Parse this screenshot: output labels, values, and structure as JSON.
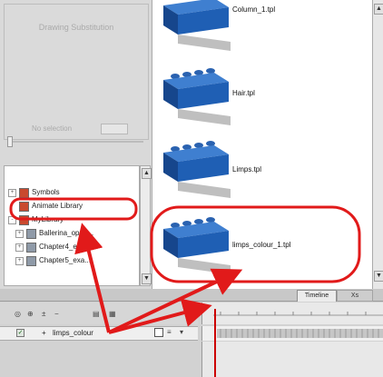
{
  "drawing_substitution": {
    "title": "Drawing Substitution",
    "no_selection": "No selection"
  },
  "library_tree": {
    "items": [
      {
        "label": "Symbols",
        "expander": "+",
        "indent": 0
      },
      {
        "label": "Animate Library",
        "expander": "",
        "indent": 0
      },
      {
        "label": "MyLibrary",
        "expander": "-",
        "indent": 0
      },
      {
        "label": "Ballerina_open...",
        "expander": "+",
        "indent": 1
      },
      {
        "label": "Chapter4_exa...",
        "expander": "+",
        "indent": 1
      },
      {
        "label": "Chapter5_exa...",
        "expander": "+",
        "indent": 1
      }
    ]
  },
  "templates": [
    {
      "label": "Column_1.tpl"
    },
    {
      "label": "Hair.tpl"
    },
    {
      "label": "Limps.tpl"
    },
    {
      "label": "limps_colour_1.tpl"
    }
  ],
  "timeline": {
    "tab_timeline": "Timeline",
    "tab_other": "Xs",
    "layer_name": "limps_colour",
    "layer_prefix": "+"
  },
  "annotation_color": "#e11a1a",
  "brick_color": "#1f5fb4"
}
